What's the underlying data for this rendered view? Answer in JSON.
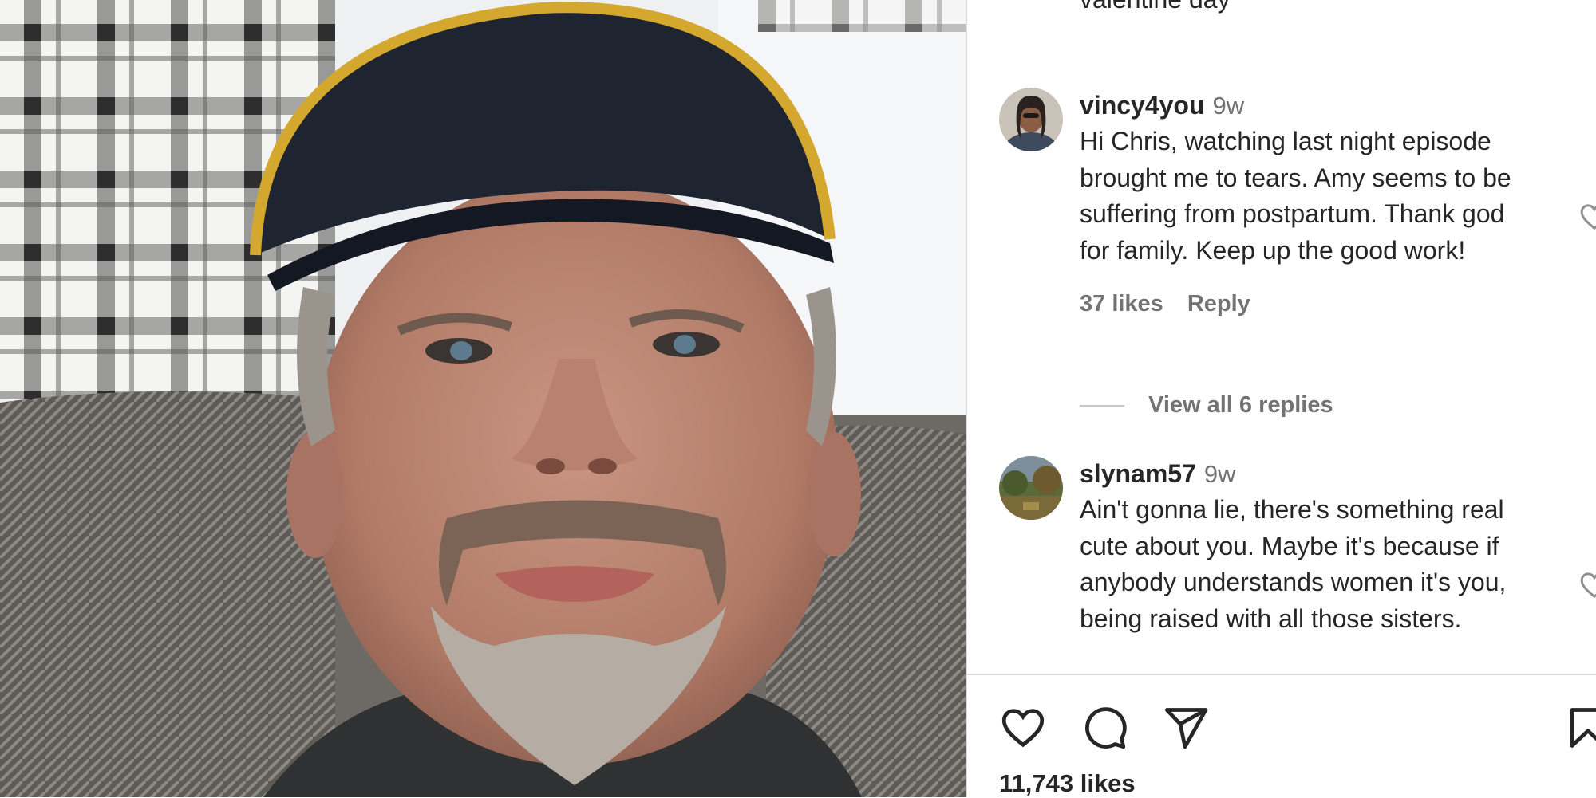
{
  "post": {
    "caption_tail": "valentine day",
    "likes_count": "11,743 likes"
  },
  "comments": [
    {
      "username": "vincy4you",
      "time": "9w",
      "text": "Hi Chris, watching last night episode brought me to tears. Amy seems to be suffering from postpartum. Thank god for family. Keep up the good work!",
      "likes": "37 likes",
      "reply_label": "Reply",
      "view_replies": "View all 6 replies"
    },
    {
      "username": "slynam57",
      "time": "9w",
      "text": "Ain't gonna lie, there's something real cute about you. Maybe it's because if anybody understands women it's you, being raised with all those sisters."
    }
  ],
  "icons": {
    "like": "heart-icon",
    "comment": "comment-bubble-icon",
    "share": "paper-plane-icon",
    "save": "bookmark-icon",
    "comment_like": "heart-outline-icon"
  },
  "colors": {
    "text": "#262626",
    "secondary_text": "#737373",
    "divider": "#dbdbdb",
    "background": "#ffffff"
  }
}
